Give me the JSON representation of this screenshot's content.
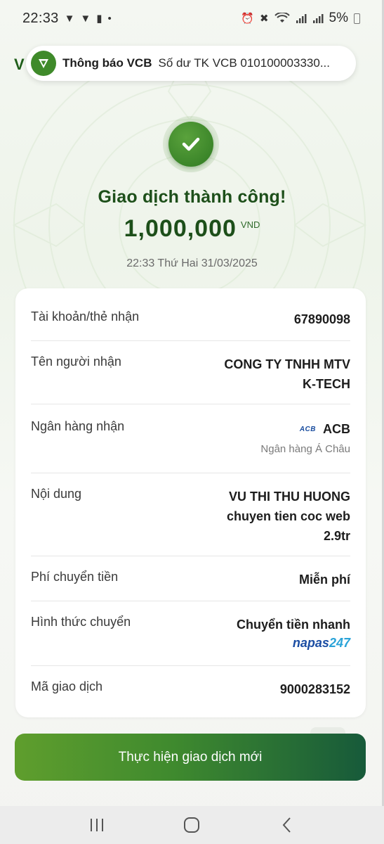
{
  "status_bar": {
    "time": "22:33",
    "left_icons": [
      "shield-icon",
      "shield-icon",
      "battery-saver-icon",
      "dot-icon"
    ],
    "right_icons": [
      "alarm-icon",
      "mute-icon",
      "wifi-icon",
      "signal-icon",
      "signal-icon"
    ],
    "battery": "5%"
  },
  "notification": {
    "app_name": "Thông báo VCB",
    "message": "Số dư TK VCB 010100003330..."
  },
  "result": {
    "title": "Giao dịch thành công!",
    "amount": "1,000,000",
    "currency": "VND",
    "datetime": "22:33 Thứ Hai 31/03/2025"
  },
  "details": {
    "account_label": "Tài khoản/thẻ nhận",
    "account_value": "67890098",
    "recipient_label": "Tên người nhận",
    "recipient_value_line1": "CONG TY TNHH MTV",
    "recipient_value_line2": "K-TECH",
    "bank_label": "Ngân hàng nhận",
    "bank_logo_text": "ACB",
    "bank_value": "ACB",
    "bank_fullname": "Ngân hàng Á Châu",
    "content_label": "Nội dung",
    "content_line1": "VU THI THU HUONG",
    "content_line2": "chuyen tien coc web",
    "content_line3": "2.9tr",
    "fee_label": "Phí chuyển tiền",
    "fee_value": "Miễn phí",
    "method_label": "Hình thức chuyển",
    "method_value": "Chuyển tiền nhanh",
    "napas_text_1": "napas",
    "napas_text_2": "247",
    "txn_label": "Mã giao dịch",
    "txn_value": "9000283152"
  },
  "actions": {
    "primary_label": "Thực hiện giao dịch mới"
  },
  "colors": {
    "brand_green": "#3f8a2a",
    "title_green": "#1d4f1a",
    "button_start": "#5f9e2d",
    "button_end": "#175a3a"
  }
}
